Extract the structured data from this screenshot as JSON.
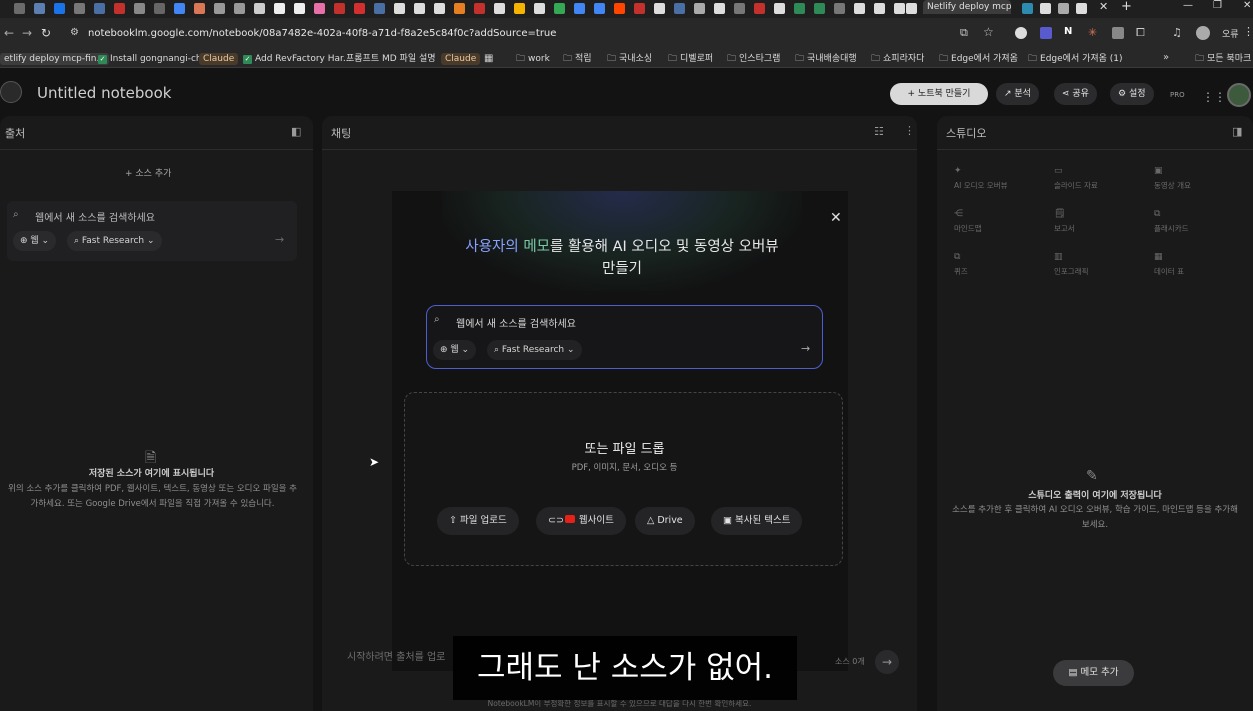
{
  "browser": {
    "active_tab_title": "Netlify deploy mcp-f",
    "url": "notebooklm.google.com/notebook/08a7482e-402a-40f8-a71d-f8a2e5c84f0c?addSource=true",
    "bookmarks": [
      {
        "label": "etlify deploy mcp-fin..."
      },
      {
        "label": "Install gongnangi-ch..."
      },
      {
        "label": "Claude"
      },
      {
        "label": "Add RevFactory Har..."
      },
      {
        "label": "프롬프트 MD 파일 설명"
      },
      {
        "label": "Claude"
      },
      {
        "label": "work"
      },
      {
        "label": "적립"
      },
      {
        "label": "국내소싱"
      },
      {
        "label": "디벨로퍼"
      },
      {
        "label": "인스타그램"
      },
      {
        "label": "국내배송대행"
      },
      {
        "label": "쇼피라자다"
      },
      {
        "label": "Edge에서 가져옴"
      },
      {
        "label": "Edge에서 가져옴 (1)"
      },
      {
        "label": "모든 북마크"
      }
    ],
    "profile_label": "오류"
  },
  "header": {
    "notebook_title": "Untitled notebook",
    "create_notebook_label": "노트북 만들기",
    "analytics_label": "분석",
    "share_label": "공유",
    "settings_label": "설정",
    "pro_label": "PRO"
  },
  "sources": {
    "title": "출처",
    "add_source_label": "소스 추가",
    "search_placeholder": "웹에서 새 소스를 검색하세요",
    "web_chip": "웹",
    "research_chip": "Fast Research",
    "empty_title": "저장된 소스가 여기에 표시됩니다",
    "empty_desc": "위의 소스 추가를 클릭하여 PDF, 웹사이트, 텍스트, 동영상 또는 오디오 파일을 추가하세요. 또는 Google Drive에서 파일을 직접 가져올 수 있습니다."
  },
  "chat": {
    "title": "채팅",
    "headline_part1": "사용자의 ",
    "headline_part2": "메모",
    "headline_part3": "를 활용해 AI 오디오 및 동영상 오버뷰 만들기",
    "search_placeholder": "웹에서 새 소스를 검색하세요",
    "web_chip": "웹",
    "research_chip": "Fast Research",
    "drop_title": "또는 파일 드롭",
    "drop_sub": "PDF, 이미지, 문서, 오디오 등",
    "upload_label": "파일 업로드",
    "website_label": "웹사이트",
    "drive_label": "Drive",
    "paste_label": "복사된 텍스트",
    "input_placeholder": "시작하려면 출처를 업로",
    "source_count": "소스 0개",
    "disclaimer": "NotebookLM이 부정확한 정보를 표시할 수 있으므로 대답을 다시 한번 확인하세요."
  },
  "studio": {
    "title": "스튜디오",
    "tools": [
      {
        "label": "AI 오디오 오버뷰",
        "icon": "audio-icon"
      },
      {
        "label": "슬라이드 자료",
        "icon": "slides-icon"
      },
      {
        "label": "동영상 개요",
        "icon": "video-icon"
      },
      {
        "label": "마인드맵",
        "icon": "mindmap-icon"
      },
      {
        "label": "보고서",
        "icon": "report-icon"
      },
      {
        "label": "플래시카드",
        "icon": "flashcard-icon"
      },
      {
        "label": "퀴즈",
        "icon": "quiz-icon"
      },
      {
        "label": "인포그래픽",
        "icon": "infographic-icon"
      },
      {
        "label": "데이터 표",
        "icon": "table-icon"
      }
    ],
    "empty_title": "스튜디오 출력이 여기에 저장됩니다",
    "empty_desc": "소스를 추가한 후 클릭하여 AI 오디오 오버뷰, 학습 가이드, 마인드맵 등을 추가해 보세요.",
    "memo_label": "메모 추가"
  },
  "overlay": {
    "subtitle": "그래도 난 소스가 없어."
  }
}
